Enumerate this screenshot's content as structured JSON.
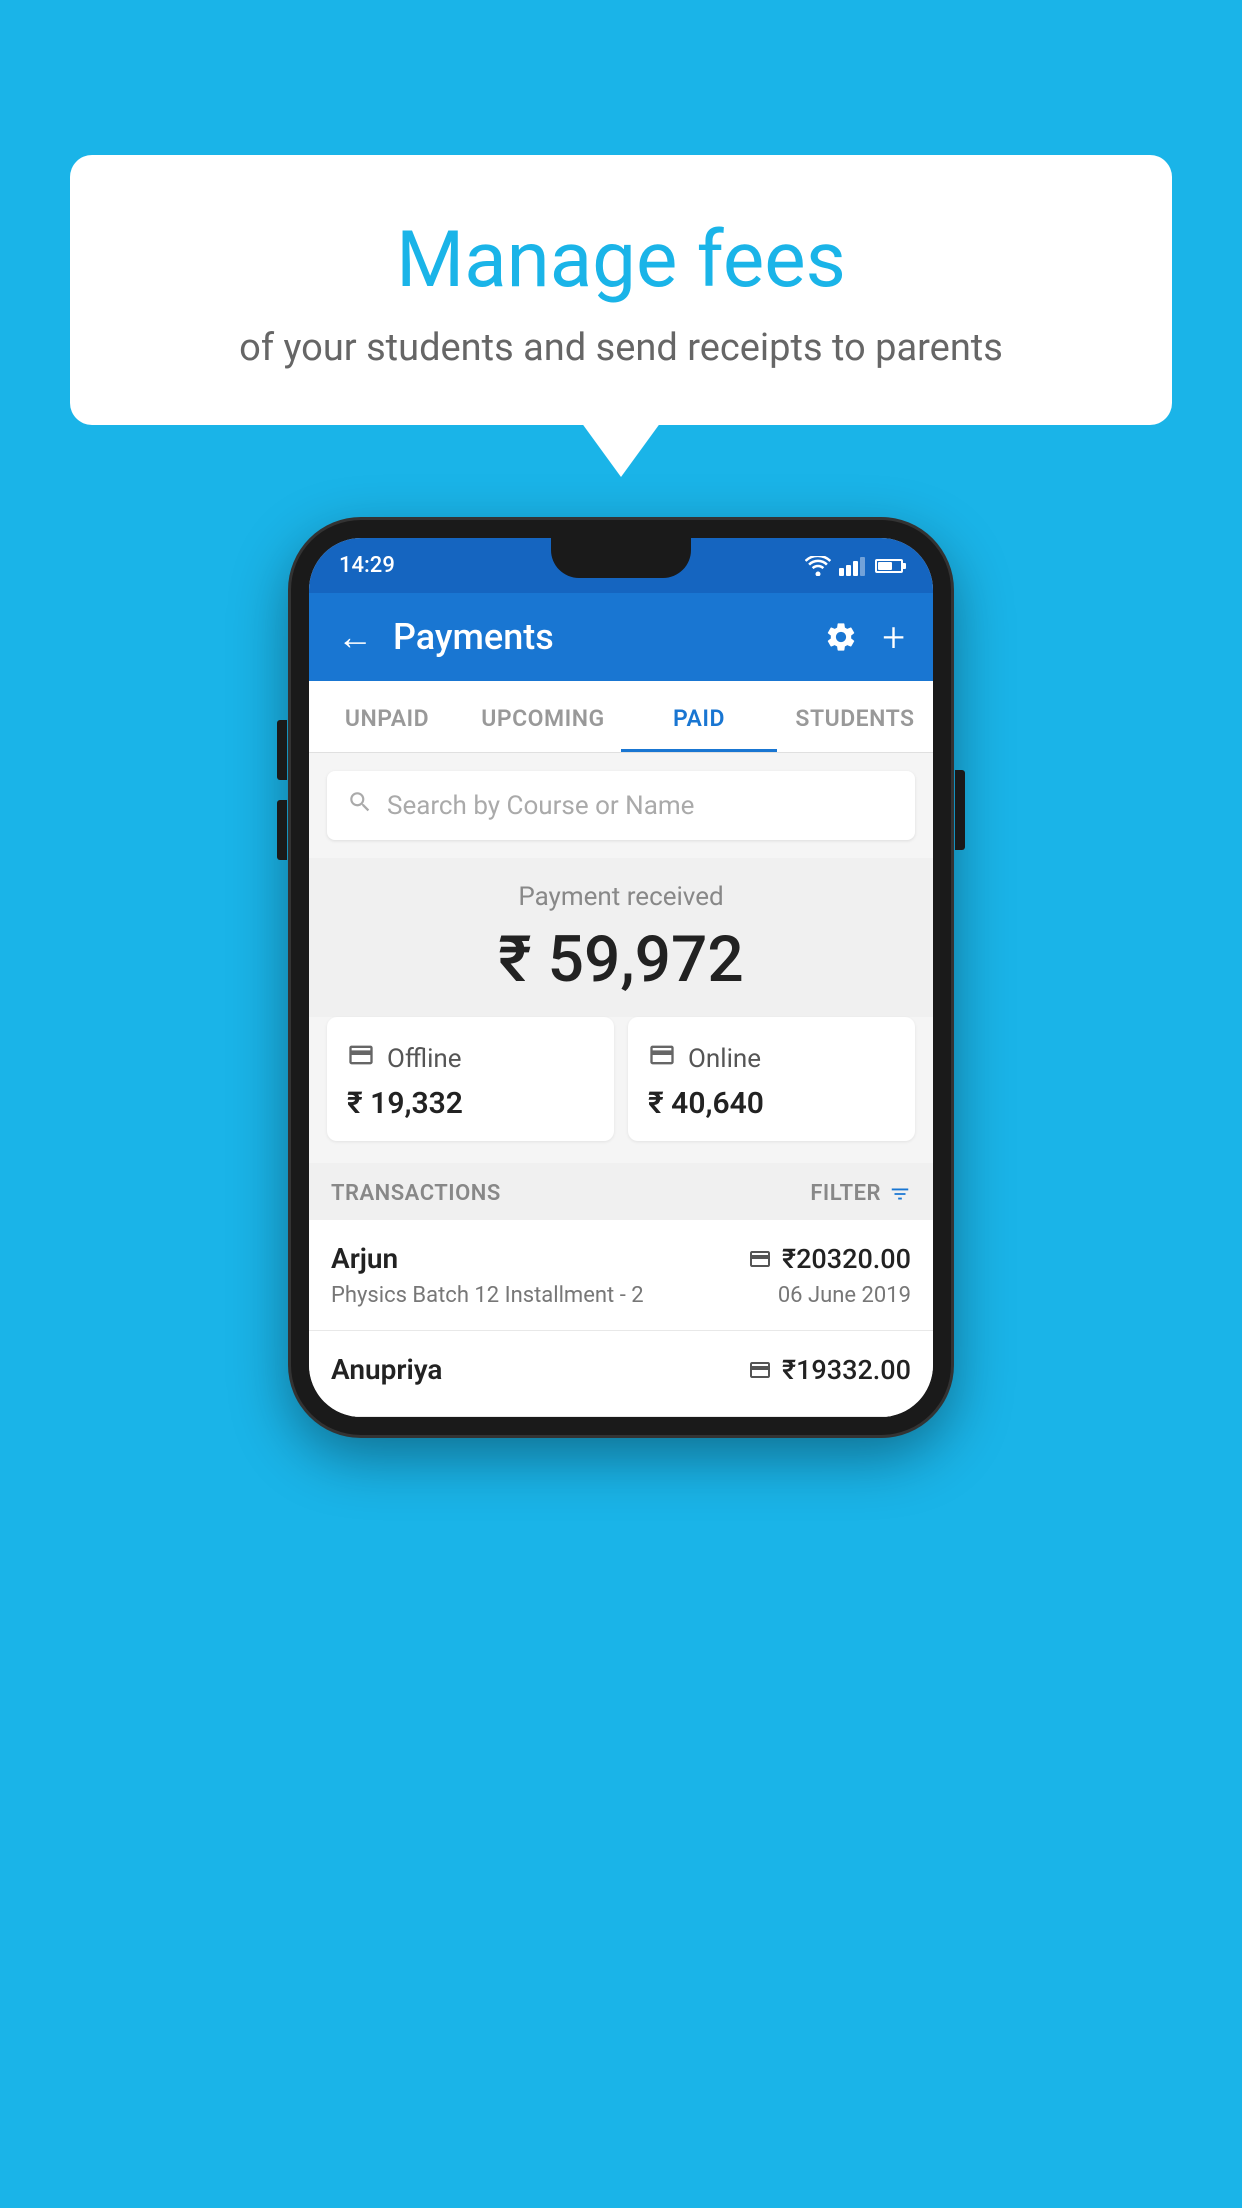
{
  "background_color": "#1ab4e8",
  "speech_bubble": {
    "title": "Manage fees",
    "subtitle": "of your students and send receipts to parents"
  },
  "status_bar": {
    "time": "14:29"
  },
  "app_bar": {
    "title": "Payments",
    "back_icon": "←",
    "settings_icon": "⚙",
    "add_icon": "+"
  },
  "tabs": [
    {
      "label": "UNPAID",
      "active": false
    },
    {
      "label": "UPCOMING",
      "active": false
    },
    {
      "label": "PAID",
      "active": true
    },
    {
      "label": "STUDENTS",
      "active": false
    }
  ],
  "search": {
    "placeholder": "Search by Course or Name"
  },
  "payment_summary": {
    "label": "Payment received",
    "amount": "₹ 59,972",
    "offline": {
      "type": "Offline",
      "amount": "₹ 19,332"
    },
    "online": {
      "type": "Online",
      "amount": "₹ 40,640"
    }
  },
  "transactions_section": {
    "label": "TRANSACTIONS",
    "filter_label": "FILTER"
  },
  "transactions": [
    {
      "name": "Arjun",
      "course": "Physics Batch 12 Installment - 2",
      "amount": "₹20320.00",
      "date": "06 June 2019",
      "mode_icon": "card"
    },
    {
      "name": "Anupriya",
      "course": "",
      "amount": "₹19332.00",
      "date": "",
      "mode_icon": "offline"
    }
  ]
}
